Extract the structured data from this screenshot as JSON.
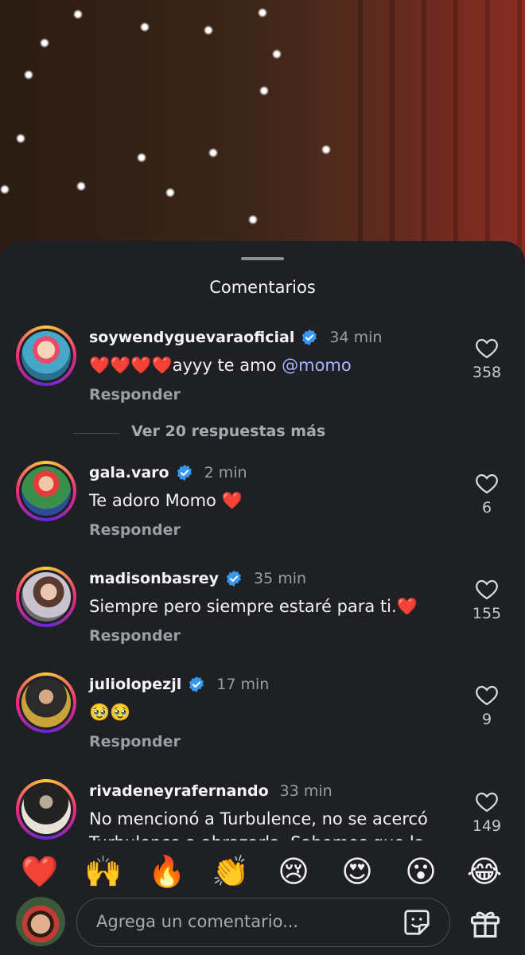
{
  "sheet": {
    "title": "Comentarios"
  },
  "comments": [
    {
      "username": "soywendyguevaraoficial",
      "verified": true,
      "time": "34 min",
      "text_emoji": "❤️❤️❤️❤️",
      "text": "ayyy te amo ",
      "mention": "@momo",
      "reply_label": "Responder",
      "likes": "358",
      "more_replies": "Ver 20 respuestas más"
    },
    {
      "username": "gala.varo",
      "verified": true,
      "time": "2 min",
      "text": "Te adoro Momo ❤️",
      "reply_label": "Responder",
      "likes": "6"
    },
    {
      "username": "madisonbasrey",
      "verified": true,
      "time": "35 min",
      "text": "Siempre pero siempre estaré para ti.❤️",
      "reply_label": "Responder",
      "likes": "155"
    },
    {
      "username": "juliolopezjl",
      "verified": true,
      "time": "17 min",
      "text": "🥹🥹",
      "reply_label": "Responder",
      "likes": "9"
    },
    {
      "username": "rivadeneyrafernando",
      "verified": false,
      "time": "33 min",
      "text": "No mencionó a Turbulence, no se acercó",
      "text2": "Turbulence a abrazarla. Sabemos que la",
      "likes": "149"
    }
  ],
  "quick_emojis": [
    "❤️",
    "🙌",
    "🔥",
    "👏",
    "😢",
    "😍",
    "😮",
    "😂"
  ],
  "composer": {
    "placeholder": "Agrega un comentario..."
  },
  "colors": {
    "sheet_bg": "#1f2024",
    "verified_blue": "#3897f0",
    "mention": "#a8b4ff"
  },
  "icons": [
    "heart-icon",
    "verified-badge-icon",
    "sticker-icon",
    "gift-icon"
  ]
}
